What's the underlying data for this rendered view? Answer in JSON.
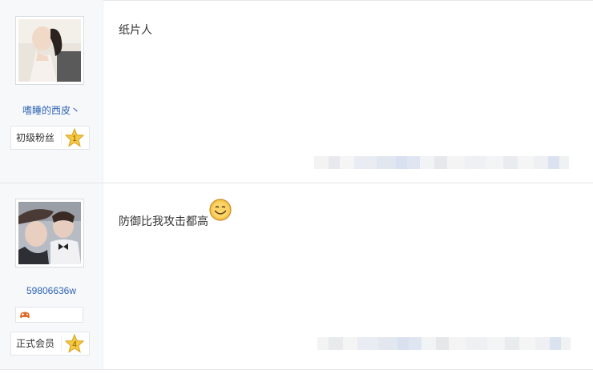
{
  "posts": [
    {
      "username": "嗜睡的西皮丶",
      "badge_label": "初级粉丝",
      "level": "1",
      "content": "纸片人",
      "avatar_icon": "avatar-photo-woman",
      "badge_icon": "level-star-icon"
    },
    {
      "username": "59806636w",
      "badge_label": "正式会员",
      "level": "4",
      "content": "防御比我攻击都高",
      "avatar_icon": "avatar-photo-two-men",
      "badge_icon": "level-star-icon",
      "extra_icon": "gamepad-icon",
      "emoji": "smile-emoji"
    }
  ],
  "colors": {
    "username": "#2d64b3",
    "sidebar_bg": "#f7f8fa",
    "star_fill": "#f5c842"
  }
}
